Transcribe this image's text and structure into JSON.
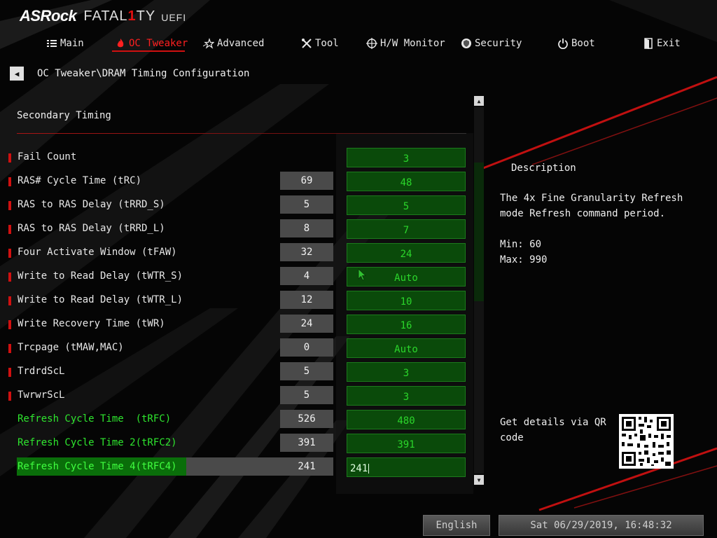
{
  "brand": {
    "logo_text": "ASRock",
    "series_prefix": "FATAL",
    "series_one": "1",
    "series_suffix": "TY",
    "uefi": "UEFI"
  },
  "menu": [
    {
      "label": "Main",
      "icon": "list-icon",
      "active": false
    },
    {
      "label": "OC Tweaker",
      "icon": "flame-icon",
      "active": true
    },
    {
      "label": "Advanced",
      "icon": "star-icon",
      "active": false
    },
    {
      "label": "Tool",
      "icon": "tools-icon",
      "active": false
    },
    {
      "label": "H/W Monitor",
      "icon": "crosshair-icon",
      "active": false
    },
    {
      "label": "Security",
      "icon": "shield-icon",
      "active": false
    },
    {
      "label": "Boot",
      "icon": "power-icon",
      "active": false
    },
    {
      "label": "Exit",
      "icon": "exit-door-icon",
      "active": false
    }
  ],
  "breadcrumb": "OC Tweaker\\DRAM Timing Configuration",
  "section_title": "Secondary Timing",
  "rows": [
    {
      "label": "Fail Count",
      "current": "",
      "setting": "3",
      "style": "normal"
    },
    {
      "label": "RAS# Cycle Time (tRC)",
      "current": "69",
      "setting": "48",
      "style": "normal"
    },
    {
      "label": "RAS to RAS Delay (tRRD_S)",
      "current": "5",
      "setting": "5",
      "style": "normal"
    },
    {
      "label": "RAS to RAS Delay (tRRD_L)",
      "current": "8",
      "setting": "7",
      "style": "normal"
    },
    {
      "label": "Four Activate Window (tFAW)",
      "current": "32",
      "setting": "24",
      "style": "normal"
    },
    {
      "label": "Write to Read Delay (tWTR_S)",
      "current": "4",
      "setting": "Auto",
      "style": "normal"
    },
    {
      "label": "Write to Read Delay (tWTR_L)",
      "current": "12",
      "setting": "10",
      "style": "normal"
    },
    {
      "label": "Write Recovery Time (tWR)",
      "current": "24",
      "setting": "16",
      "style": "normal"
    },
    {
      "label": "Trcpage (tMAW,MAC)",
      "current": "0",
      "setting": "Auto",
      "style": "normal"
    },
    {
      "label": "TrdrdScL",
      "current": "5",
      "setting": "3",
      "style": "normal"
    },
    {
      "label": "TwrwrScL",
      "current": "5",
      "setting": "3",
      "style": "normal"
    },
    {
      "label": "Refresh Cycle Time  (tRFC)",
      "current": "526",
      "setting": "480",
      "style": "green"
    },
    {
      "label": "Refresh Cycle Time 2(tRFC2)",
      "current": "391",
      "setting": "391",
      "style": "green"
    },
    {
      "label": "Refresh Cycle Time 4(tRFC4)",
      "current": "241",
      "setting": "241",
      "style": "selected"
    }
  ],
  "description": {
    "title": "Description",
    "text": "The 4x Fine Granularity Refresh\nmode Refresh command period.",
    "min": "Min: 60",
    "max": "Max: 990",
    "qr_text": "Get details via QR code"
  },
  "footer": {
    "language": "English",
    "datetime": "Sat 06/29/2019, 16:48:32"
  },
  "colors": {
    "accent_red": "#d01010",
    "setting_green": "#0a4a0a",
    "label_green": "#2ee62e"
  }
}
